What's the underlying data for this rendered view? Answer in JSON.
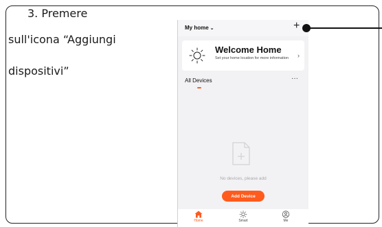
{
  "instruction": {
    "line1": "3. Premere",
    "line2": "sull'icona “Aggiungi",
    "line3": "dispositivi”"
  },
  "app": {
    "home_selector": "My home",
    "add_icon": "+",
    "welcome": {
      "title": "Welcome Home",
      "subtitle": "Set your home location for more information",
      "chevron": "›"
    },
    "devices_tab": "All Devices",
    "more_icon": "···",
    "empty_text": "No devices, please add",
    "add_device_button": "Add Device",
    "tabbar": [
      {
        "label": "Home",
        "icon": "home-icon",
        "active": true
      },
      {
        "label": "Smart",
        "icon": "sun-icon",
        "active": false
      },
      {
        "label": "Me",
        "icon": "profile-icon",
        "active": false
      }
    ]
  },
  "colors": {
    "accent": "#ff5b1d",
    "screen_bg": "#f2f2f4",
    "text": "#111111"
  }
}
